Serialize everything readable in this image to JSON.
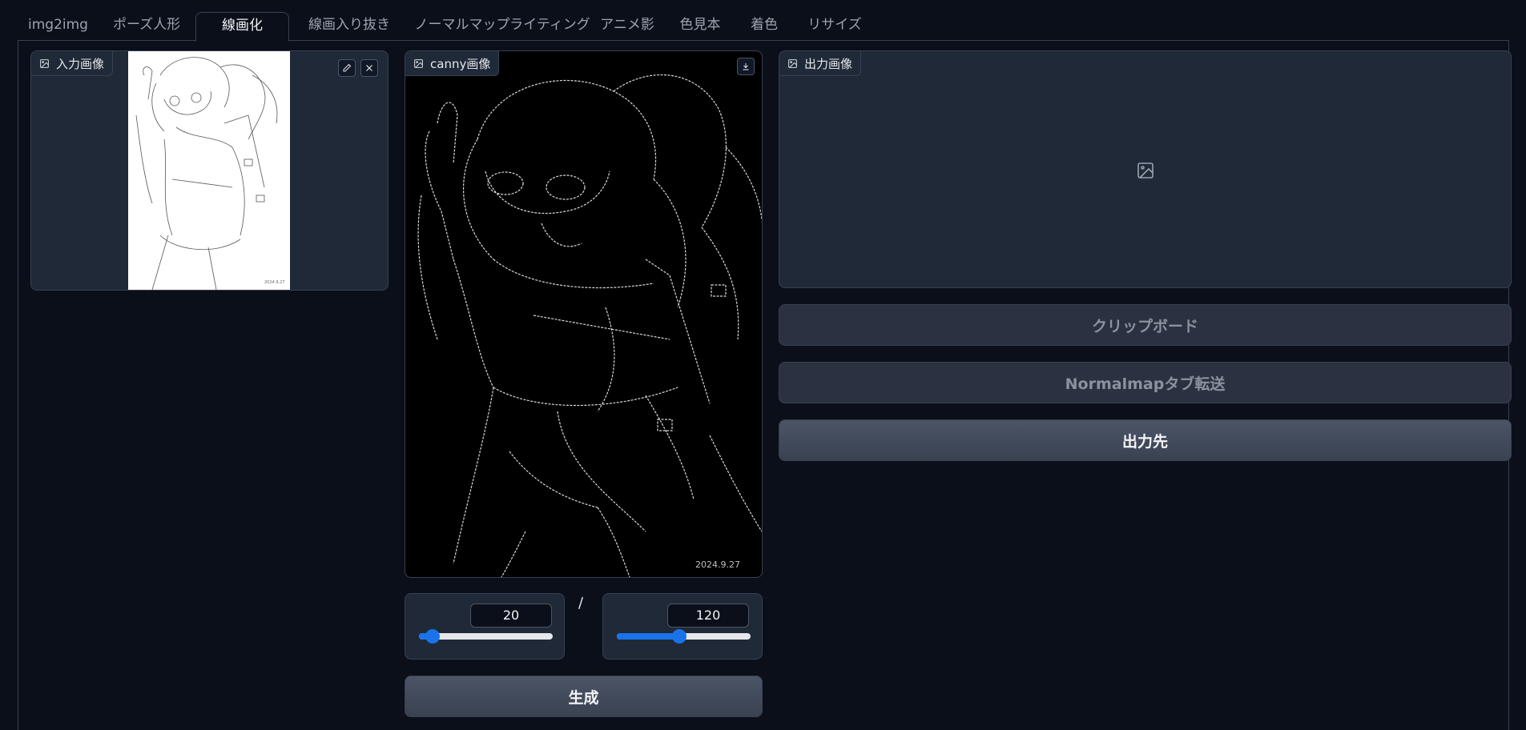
{
  "tabs": [
    {
      "label": "img2img"
    },
    {
      "label": "ポーズ人形"
    },
    {
      "label": "線画化"
    },
    {
      "label": "線画入り抜き"
    },
    {
      "label": "ノーマルマップ"
    },
    {
      "label": "ライティング"
    },
    {
      "label": "アニメ影"
    },
    {
      "label": "色見本"
    },
    {
      "label": "着色"
    },
    {
      "label": "リサイズ"
    }
  ],
  "active_tab": "線画化",
  "input_panel": {
    "label": "入力画像"
  },
  "canny_panel": {
    "label": "canny画像",
    "signature": "2024.9.27"
  },
  "output_panel": {
    "label": "出力画像"
  },
  "sliders": {
    "low": {
      "value": "20",
      "fraction": 0.1
    },
    "separator": "/",
    "high": {
      "value": "120",
      "fraction": 0.47
    }
  },
  "buttons": {
    "generate": "生成",
    "clipboard": "クリップボード",
    "normalmap_transfer": "Normalmapタブ転送",
    "output_dest": "出力先"
  },
  "colors": {
    "background": "#0b0f19",
    "panel": "#1f2937",
    "accent": "#1a73e8"
  }
}
